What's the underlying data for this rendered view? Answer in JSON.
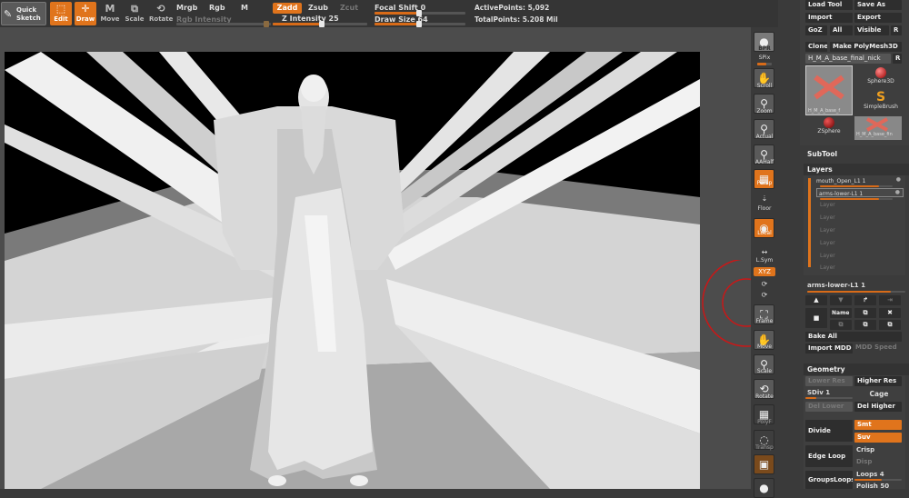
{
  "toolbar": {
    "quick_sketch": "Quick\nSketch",
    "edit": "Edit",
    "draw": "Draw",
    "move": "Move",
    "scale": "Scale",
    "rotate": "Rotate",
    "mrgb": "Mrgb",
    "rgb": "Rgb",
    "m": "M",
    "rgb_intensity": "Rgb Intensity",
    "zadd": "Zadd",
    "zsub": "Zsub",
    "zcut": "Zcut",
    "z_intensity": "Z Intensity 25",
    "focal_shift": "Focal Shift 0",
    "draw_size": "Draw Size 64",
    "active_points": "ActivePoints: 5,092",
    "total_points": "TotalPoints: 5.208 Mil",
    "accent": "#e0741c"
  },
  "shelf": {
    "bpr": "BPR",
    "spix": "SPix",
    "scroll": "Scroll",
    "zoom": "Zoom",
    "actual": "Actual",
    "aahalf": "AAHalf",
    "persp": "Persp",
    "floor": "Floor",
    "local": "Local",
    "lsym": "L.Sym",
    "xyz": "XYZ",
    "frame": "Frame",
    "move": "Move",
    "scale": "Scale",
    "rotate": "Rotate",
    "polyf": "PolyF",
    "transp": "Transp"
  },
  "tool": {
    "load_tool": "Load Tool",
    "save_as": "Save As",
    "import": "Import",
    "export": "Export",
    "goz": "GoZ",
    "all": "All",
    "visible": "Visible",
    "r": "R",
    "clone": "Clone",
    "make_polymesh": "Make PolyMesh3D",
    "current_tool": "H_M_A_base_final_nick",
    "thumb_label_1": "H_M_A_base_f",
    "sphere3d": "Sphere3D",
    "simplebrush": "SimpleBrush",
    "zsphere": "ZSphere",
    "thumb_label_2": "H_M_A_base_fin"
  },
  "subtool": {
    "header": "SubTool"
  },
  "layers": {
    "header": "Layers",
    "items": [
      "mouth_Open_L1 1",
      "arms-lower-L1 1",
      "Layer",
      "Layer",
      "Layer",
      "Layer",
      "Layer",
      "Layer"
    ],
    "current": "arms-lower-L1 1",
    "name_btn": "Name",
    "bake_all": "Bake All",
    "import_mdd": "Import MDD",
    "mdd_speed": "MDD Speed"
  },
  "geometry": {
    "header": "Geometry",
    "lower_res": "Lower Res",
    "higher_res": "Higher Res",
    "sdiv": "SDiv 1",
    "cage": "Cage",
    "del_lower": "Del Lower",
    "del_higher": "Del Higher",
    "divide": "Divide",
    "smt": "Smt",
    "suv": "Suv",
    "edge_loop": "Edge Loop",
    "crisp": "Crisp",
    "disp": "Disp",
    "loops": "Loops 4",
    "groups_loops": "GroupsLoops",
    "polish": "Polish 50"
  }
}
